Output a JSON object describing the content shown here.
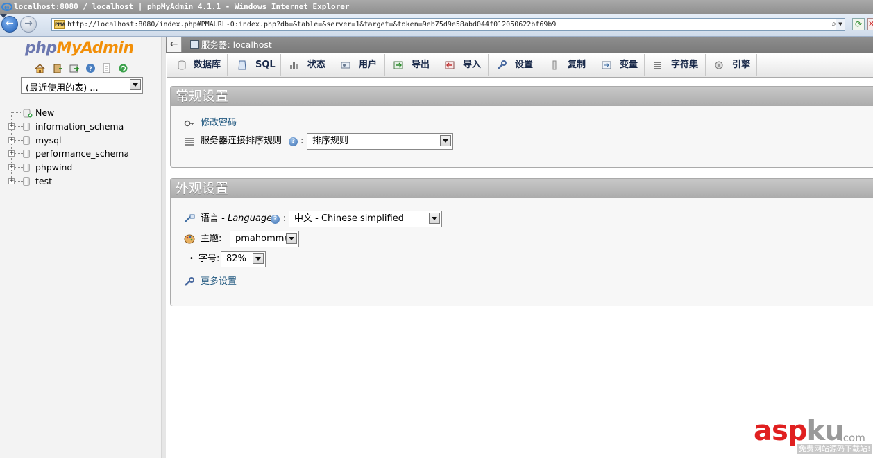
{
  "window": {
    "title": "localhost:8080 / localhost | phpMyAdmin 4.1.1 - Windows Internet Explorer"
  },
  "browser": {
    "url": "http://localhost:8080/index.php#PMAURL-0:index.php?db=&table=&server=1&target=&token=9eb75d9e58abd044f012050622bf69b9",
    "favicon_text": "PMA"
  },
  "logo": {
    "php": "php",
    "myadmin": "MyAdmin"
  },
  "sidebar": {
    "recent_select": "(最近使用的表) ...",
    "tree": [
      {
        "label": "New"
      },
      {
        "label": "information_schema"
      },
      {
        "label": "mysql"
      },
      {
        "label": "performance_schema"
      },
      {
        "label": "phpwind"
      },
      {
        "label": "test"
      }
    ],
    "icons": [
      "home-icon",
      "exit-icon",
      "query-window-icon",
      "help-icon",
      "docs-icon",
      "reload-icon"
    ]
  },
  "server_bar": {
    "collapse": "←",
    "label": "服务器: localhost"
  },
  "tabs": [
    {
      "label": "数据库",
      "icon": "database-icon"
    },
    {
      "label": "SQL",
      "icon": "sql-icon"
    },
    {
      "label": "状态",
      "icon": "status-icon"
    },
    {
      "label": "用户",
      "icon": "users-icon"
    },
    {
      "label": "导出",
      "icon": "export-icon"
    },
    {
      "label": "导入",
      "icon": "import-icon"
    },
    {
      "label": "设置",
      "icon": "settings-icon"
    },
    {
      "label": "复制",
      "icon": "replication-icon"
    },
    {
      "label": "变量",
      "icon": "variables-icon"
    },
    {
      "label": "字符集",
      "icon": "charset-icon"
    },
    {
      "label": "引擎",
      "icon": "engines-icon"
    }
  ],
  "general_settings": {
    "title": "常规设置",
    "change_password": "修改密码",
    "collation_label": "服务器连接排序规则",
    "collation_value": "排序规则",
    "colon": ":"
  },
  "appearance_settings": {
    "title": "外观设置",
    "language_label": "语言 - ",
    "language_label_en": "Language",
    "language_value": "中文 - Chinese simplified",
    "theme_label": "主题:",
    "theme_value": "pmahomme",
    "font_size_label": "字号:",
    "font_size_value": "82%",
    "more_settings": "更多设置",
    "colon": ":"
  },
  "watermark": {
    "main_red": "asp",
    "main_gray": "ku",
    "domain": ".com",
    "sub": "免费网站源码下载站!"
  }
}
